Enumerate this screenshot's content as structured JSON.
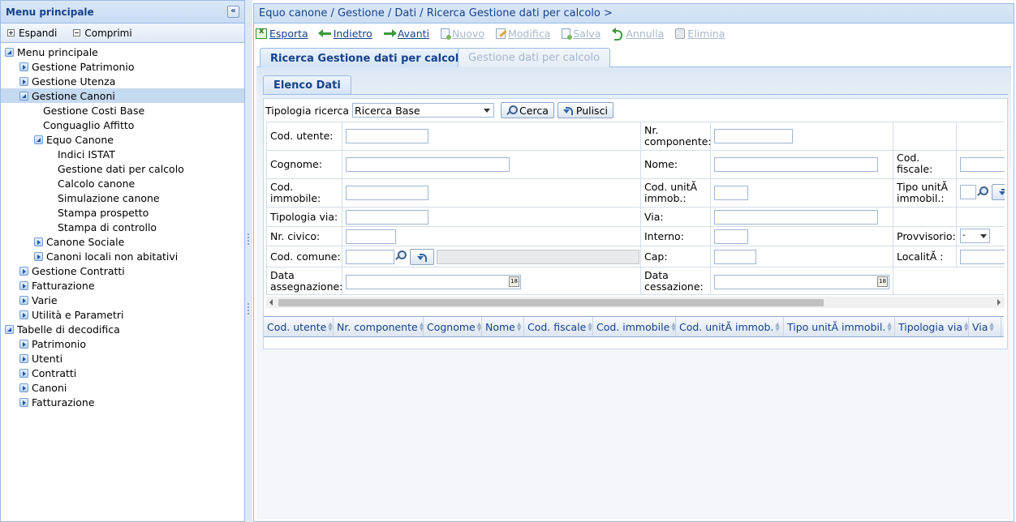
{
  "sidebar": {
    "title": "Menu principale",
    "collapse_glyph": "«",
    "toolbar": {
      "expand": "Espandi",
      "collapse": "Comprimi"
    },
    "tree": [
      {
        "label": "Menu principale",
        "level": 0,
        "icon": "expand-open"
      },
      {
        "label": "Gestione Patrimonio",
        "level": 1,
        "icon": "expand-closed"
      },
      {
        "label": "Gestione Utenza",
        "level": 1,
        "icon": "expand-closed"
      },
      {
        "label": "Gestione Canoni",
        "level": 1,
        "icon": "expand-open",
        "selected": true
      },
      {
        "label": "Gestione Costi Base",
        "level": 2,
        "icon": "leaf"
      },
      {
        "label": "Conguaglio Affitto",
        "level": 2,
        "icon": "leaf"
      },
      {
        "label": "Equo Canone",
        "level": 2,
        "icon": "expand-open"
      },
      {
        "label": "Indici ISTAT",
        "level": 3,
        "icon": "leaf"
      },
      {
        "label": "Gestione dati per calcolo",
        "level": 3,
        "icon": "leaf"
      },
      {
        "label": "Calcolo canone",
        "level": 3,
        "icon": "leaf"
      },
      {
        "label": "Simulazione canone",
        "level": 3,
        "icon": "leaf"
      },
      {
        "label": "Stampa prospetto",
        "level": 3,
        "icon": "leaf"
      },
      {
        "label": "Stampa di controllo",
        "level": 3,
        "icon": "leaf"
      },
      {
        "label": "Canone Sociale",
        "level": 2,
        "icon": "expand-closed"
      },
      {
        "label": "Canoni locali non abitativi",
        "level": 2,
        "icon": "expand-closed"
      },
      {
        "label": "Gestione Contratti",
        "level": 1,
        "icon": "expand-closed"
      },
      {
        "label": "Fatturazione",
        "level": 1,
        "icon": "expand-closed"
      },
      {
        "label": "Varie",
        "level": 1,
        "icon": "expand-closed"
      },
      {
        "label": "Utilità e Parametri",
        "level": 1,
        "icon": "expand-closed"
      },
      {
        "label": "Tabelle di decodifica",
        "level": 0,
        "icon": "expand-open"
      },
      {
        "label": "Patrimonio",
        "level": 1,
        "icon": "expand-closed"
      },
      {
        "label": "Utenti",
        "level": 1,
        "icon": "expand-closed"
      },
      {
        "label": "Contratti",
        "level": 1,
        "icon": "expand-closed"
      },
      {
        "label": "Canoni",
        "level": 1,
        "icon": "expand-closed"
      },
      {
        "label": "Fatturazione",
        "level": 1,
        "icon": "expand-closed"
      }
    ]
  },
  "main": {
    "breadcrumb": "Equo canone / Gestione / Dati / Ricerca Gestione dati per calcolo >",
    "toolbar": {
      "esporta": " Esporta",
      "indietro": " Indietro",
      "avanti": " Avanti",
      "nuovo": "Nuovo",
      "modifica": "Modifica",
      "salva": "Salva",
      "annulla": "Annulla",
      "elimina": "Elimina"
    },
    "tabs": {
      "active": "Ricerca Gestione dati per calcolo",
      "inactive": "Gestione dati per calcolo"
    },
    "subtab": "Elenco Dati",
    "search": {
      "label": "Tipologia ricerca",
      "selected": "Ricerca Base",
      "cerca": "Cerca",
      "pulisci": "Pulisci"
    },
    "form": {
      "cod_utente": "Cod. utente:",
      "nr_componente": "Nr. componente:",
      "cognome": "Cognome:",
      "nome": "Nome:",
      "cod_fiscale": "Cod. fiscale:",
      "cod_immobile": "Cod. immobile:",
      "cod_unita": "Cod. unitĂ  immob.:",
      "tipo_unita": "Tipo unitĂ  immobil.:",
      "tipologia_via": "Tipologia via:",
      "via": "Via:",
      "nr_civico": "Nr. civico:",
      "interno": "Interno:",
      "provvisorio": "Provvisorio:",
      "provvisorio_value": "-",
      "cod_comune": "Cod. comune:",
      "cap": "Cap:",
      "localita": "LocalitĂ :",
      "data_assegnazione": "Data assegnazione:",
      "data_cessazione": "Data cessazione:",
      "cal_glyph": "18"
    },
    "grid_columns": [
      {
        "label": "Cod. utente"
      },
      {
        "label": "Nr. componente"
      },
      {
        "label": "Cognome"
      },
      {
        "label": "Nome"
      },
      {
        "label": "Cod. fiscale"
      },
      {
        "label": "Cod. immobile"
      },
      {
        "label": "Cod. unitĂ   immob."
      },
      {
        "label": "Tipo unitĂ   immobil."
      },
      {
        "label": "Tipologia via"
      },
      {
        "label": "Via"
      }
    ]
  }
}
